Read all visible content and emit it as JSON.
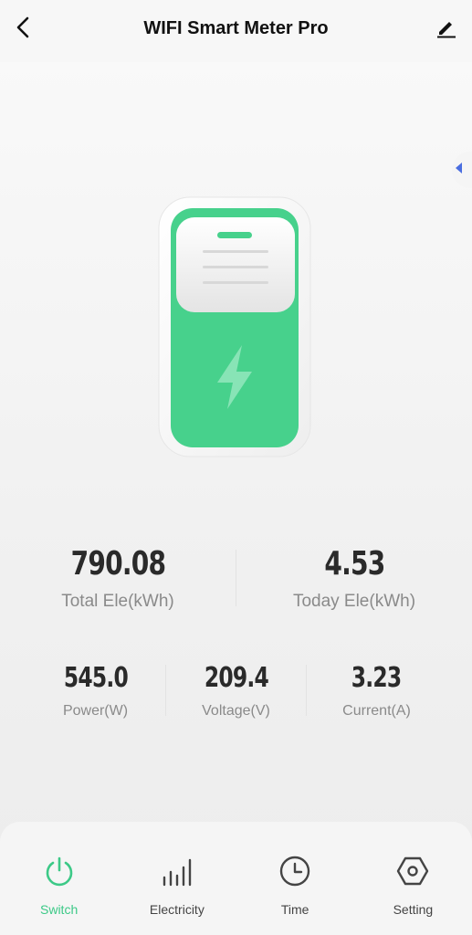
{
  "header": {
    "title": "WIFI Smart Meter Pro",
    "back_icon": "chevron-left-icon",
    "edit_icon": "pencil-icon"
  },
  "side_handle": {
    "icon": "triangle-left-icon",
    "color": "#4a6ee0"
  },
  "device": {
    "icon": "lightning-bolt-icon",
    "accent": "#47d18c"
  },
  "stats_primary": [
    {
      "value": "790.08",
      "label": "Total Ele(kWh)"
    },
    {
      "value": "4.53",
      "label": "Today Ele(kWh)"
    }
  ],
  "stats_secondary": [
    {
      "value": "545.0",
      "label": "Power(W)"
    },
    {
      "value": "209.4",
      "label": "Voltage(V)"
    },
    {
      "value": "3.23",
      "label": "Current(A)"
    }
  ],
  "tabs": [
    {
      "label": "Switch",
      "icon": "power-icon",
      "active": true
    },
    {
      "label": "Electricity",
      "icon": "bar-chart-icon",
      "active": false
    },
    {
      "label": "Time",
      "icon": "clock-icon",
      "active": false
    },
    {
      "label": "Setting",
      "icon": "hexagon-settings-icon",
      "active": false
    }
  ],
  "colors": {
    "accent": "#3cc987",
    "text_dark": "#2a2a2a",
    "text_muted": "#8a8a8a"
  }
}
